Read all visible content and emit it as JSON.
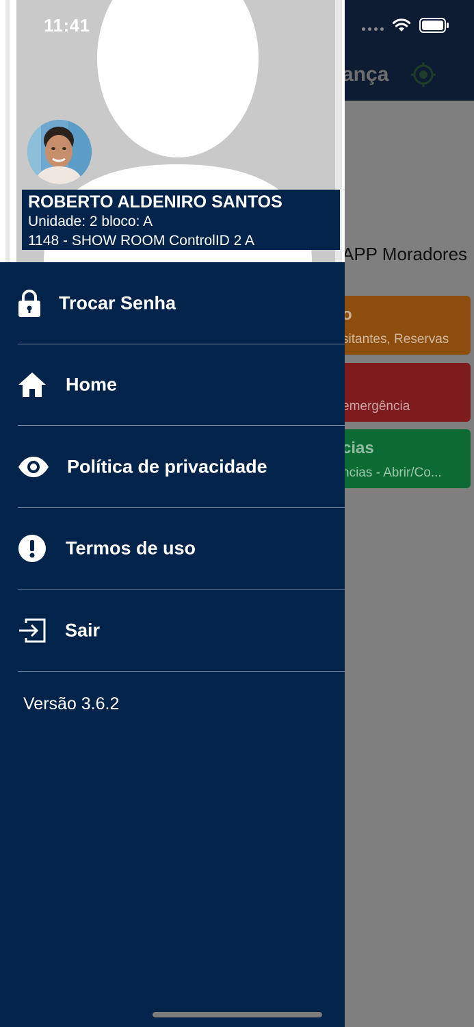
{
  "status_bar": {
    "time": "11:41"
  },
  "background": {
    "header_title": "ança",
    "welcome_text": "APP Moradores",
    "cards": [
      {
        "title": "o",
        "subtitle": "sitantes, Reservas",
        "color": "#8c4d0d"
      },
      {
        "title": "",
        "subtitle": "emergência",
        "color": "#7e1b1d"
      },
      {
        "title": "cias",
        "subtitle": "ncias - Abrir/Co...",
        "color": "#0b6b33"
      }
    ]
  },
  "drawer": {
    "user": {
      "name": "ROBERTO ALDENIRO SANTOS",
      "unit": "Unidade: 2 bloco: A",
      "condo": "1148 - SHOW ROOM ControlID 2 A"
    },
    "menu": [
      {
        "label": "Trocar Senha",
        "icon": "lock-icon"
      },
      {
        "label": "Home",
        "icon": "home-icon"
      },
      {
        "label": "Política de privacidade",
        "icon": "eye-icon"
      },
      {
        "label": "Termos de uso",
        "icon": "alert-circle-icon"
      },
      {
        "label": "Sair",
        "icon": "logout-icon"
      }
    ],
    "version": "Versão 3.6.2"
  },
  "colors": {
    "drawer_bg": "#03244a",
    "overlay_bg": "#7f7f7f",
    "header_bg": "#0e1c33"
  }
}
